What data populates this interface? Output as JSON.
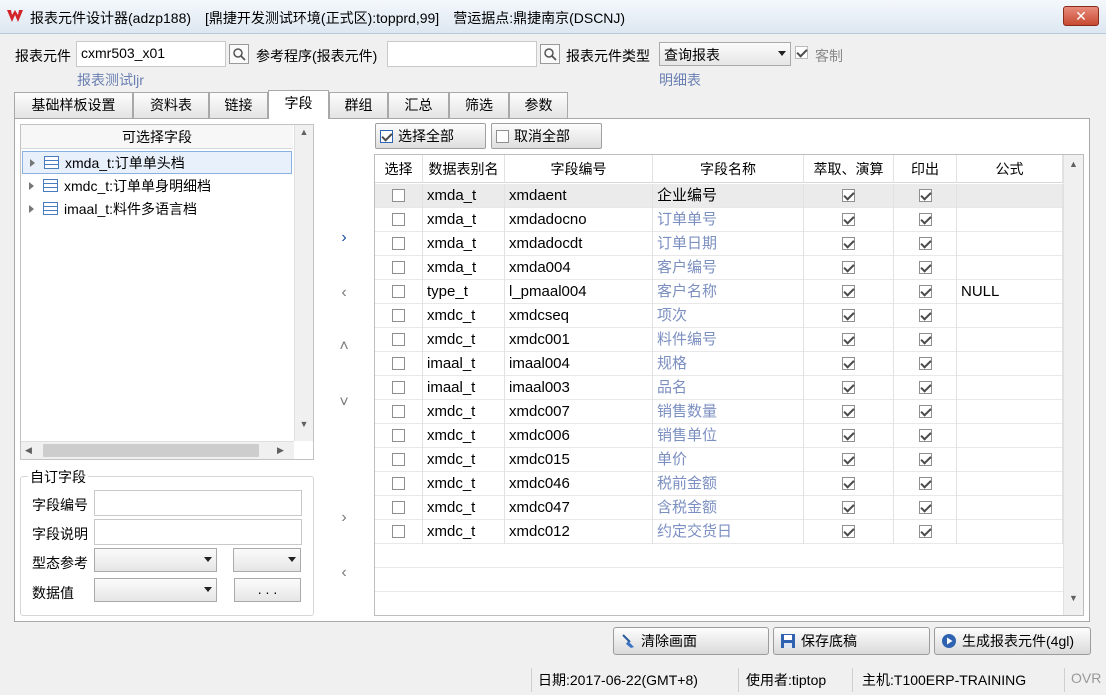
{
  "window": {
    "title": "报表元件设计器(adzp188)　[鼎捷开发测试环境(正式区):topprd,99]　营运据点:鼎捷南京(DSCNJ)",
    "close": "✕"
  },
  "header": {
    "element_label": "报表元件",
    "element_value": "cxmr503_x01",
    "element_desc": "报表测试ljr",
    "ref_label": "参考程序(报表元件)",
    "ref_value": "",
    "type_label": "报表元件类型",
    "type_value": "查询报表",
    "type_desc": "明细表",
    "custom_label": "客制"
  },
  "tabs": [
    {
      "label": "基础样板设置"
    },
    {
      "label": "资料表"
    },
    {
      "label": "链接"
    },
    {
      "label": "字段"
    },
    {
      "label": "群组"
    },
    {
      "label": "汇总"
    },
    {
      "label": "筛选"
    },
    {
      "label": "参数"
    }
  ],
  "tree": {
    "header": "可选择字段",
    "items": [
      {
        "label": "xmda_t:订单单头档"
      },
      {
        "label": "xmdc_t:订单单身明细档"
      },
      {
        "label": "imaal_t:料件多语言档"
      }
    ]
  },
  "custom_fields": {
    "title": "自订字段",
    "field_no_label": "字段编号",
    "field_desc_label": "字段说明",
    "type_ref_label": "型态参考",
    "data_value_label": "数据值",
    "dots": ". . ."
  },
  "actions": {
    "select_all": "选择全部",
    "deselect_all": "取消全部"
  },
  "grid": {
    "columns": [
      "选择",
      "数据表别名",
      "字段编号",
      "字段名称",
      "萃取、演算",
      "印出",
      "公式"
    ],
    "rows": [
      {
        "alias": "xmda_t",
        "field": "xmdaent",
        "name": "企业编号",
        "formula": ""
      },
      {
        "alias": "xmda_t",
        "field": "xmdadocno",
        "name": "订单单号",
        "formula": ""
      },
      {
        "alias": "xmda_t",
        "field": "xmdadocdt",
        "name": "订单日期",
        "formula": ""
      },
      {
        "alias": "xmda_t",
        "field": "xmda004",
        "name": "客户编号",
        "formula": ""
      },
      {
        "alias": "type_t",
        "field": "l_pmaal004",
        "name": "客户名称",
        "formula": "NULL"
      },
      {
        "alias": "xmdc_t",
        "field": "xmdcseq",
        "name": "项次",
        "formula": ""
      },
      {
        "alias": "xmdc_t",
        "field": "xmdc001",
        "name": "料件编号",
        "formula": ""
      },
      {
        "alias": "imaal_t",
        "field": "imaal004",
        "name": "规格",
        "formula": ""
      },
      {
        "alias": "imaal_t",
        "field": "imaal003",
        "name": "品名",
        "formula": ""
      },
      {
        "alias": "xmdc_t",
        "field": "xmdc007",
        "name": "销售数量",
        "formula": ""
      },
      {
        "alias": "xmdc_t",
        "field": "xmdc006",
        "name": "销售单位",
        "formula": ""
      },
      {
        "alias": "xmdc_t",
        "field": "xmdc015",
        "name": "单价",
        "formula": ""
      },
      {
        "alias": "xmdc_t",
        "field": "xmdc046",
        "name": "税前金额",
        "formula": ""
      },
      {
        "alias": "xmdc_t",
        "field": "xmdc047",
        "name": "含税金额",
        "formula": ""
      },
      {
        "alias": "xmdc_t",
        "field": "xmdc012",
        "name": "约定交货日",
        "formula": ""
      }
    ]
  },
  "buttons": {
    "clear": "清除画面",
    "save": "保存底稿",
    "generate": "生成报表元件(4gl)"
  },
  "status": {
    "date": "日期:2017-06-22(GMT+8)",
    "user": "使用者:tiptop",
    "host": "主机:T100ERP-TRAINING",
    "mode": "OVR"
  },
  "colors": {
    "hint": "#6a7fb2",
    "name_text": "#7b8fc0",
    "arrow_active": "#1a4fa0"
  }
}
